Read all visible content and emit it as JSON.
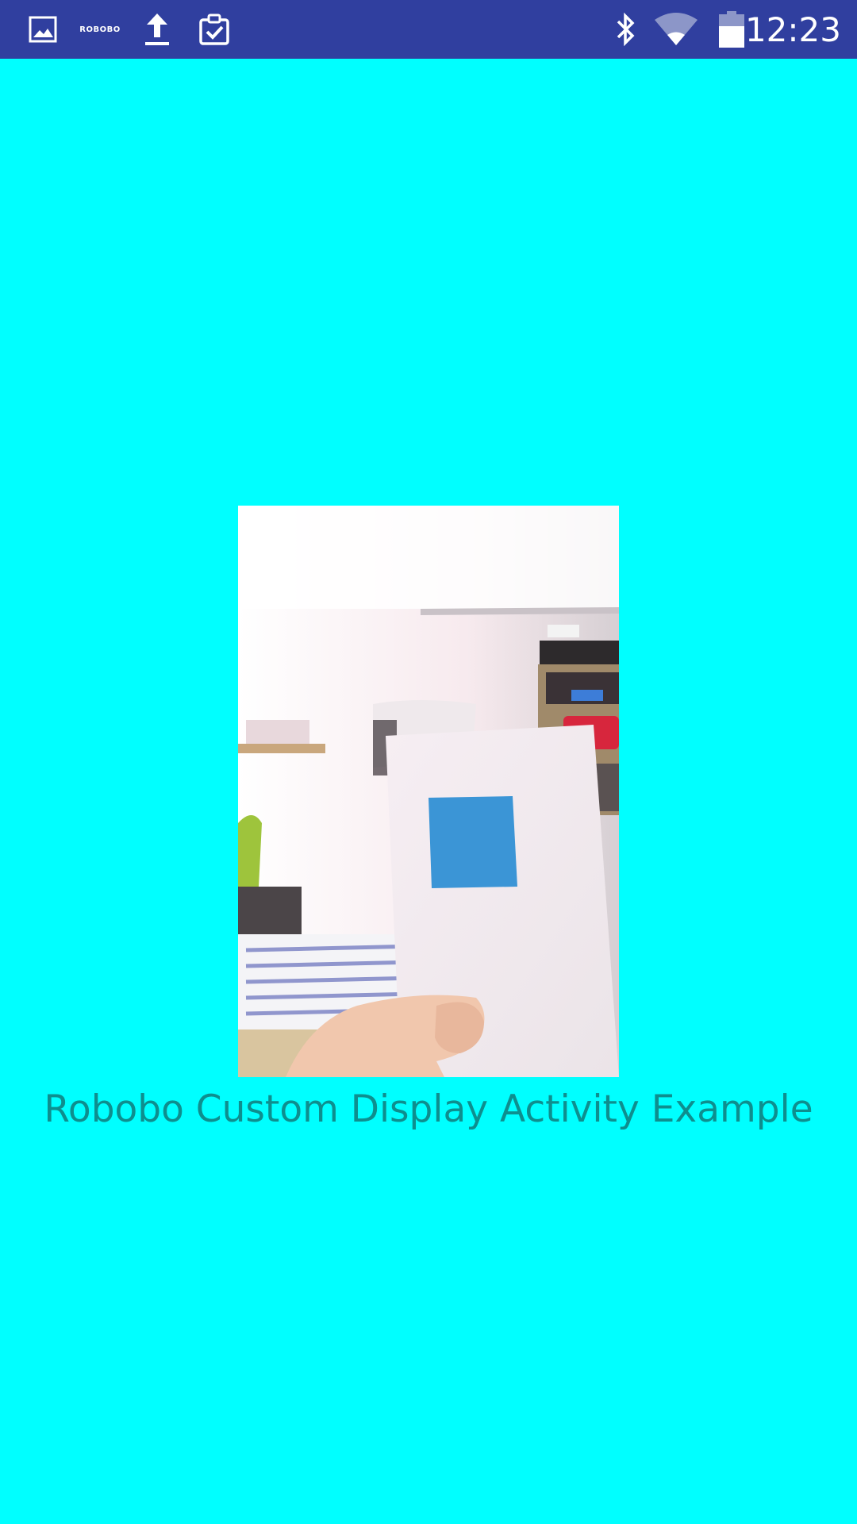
{
  "status_bar": {
    "icons": {
      "gallery": "image-icon",
      "robobo": "ROBOBO",
      "upload": "upload-icon",
      "clipboard": "clipboard-check-icon",
      "bluetooth": "bluetooth-icon",
      "wifi": "wifi-icon",
      "battery": "battery-icon"
    },
    "time": "12:23",
    "colors": {
      "background": "#303f9f",
      "foreground": "#ffffff"
    }
  },
  "main": {
    "background_color": "#00ffff",
    "camera_preview": {
      "scene": "photo of a hand holding a white card with a blue square"
    },
    "caption": "Robobo Custom Display Activity Example",
    "caption_color": "#0e8e8e"
  }
}
